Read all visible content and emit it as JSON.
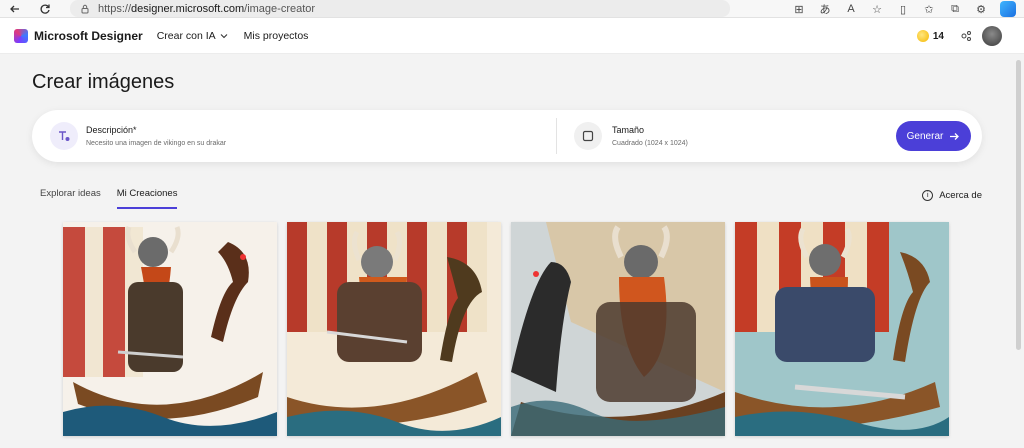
{
  "browser": {
    "url_scheme": "https://",
    "url_host": "designer.microsoft.com",
    "url_path": "/image-creator"
  },
  "header": {
    "brand": "Microsoft Designer",
    "menu": [
      {
        "label": "Crear con IA"
      },
      {
        "label": "Mis proyectos"
      }
    ],
    "coins": "14"
  },
  "main": {
    "title": "Crear imágenes",
    "prompt": {
      "description_label": "Descripción*",
      "description_value": "Necesito una imagen de vikingo en su drakar",
      "size_label": "Tamaño",
      "size_value": "Cuadrado (1024 x 1024)",
      "generate_label": "Generar"
    },
    "tabs": [
      {
        "label": "Explorar ideas"
      },
      {
        "label": "Mi Creaciones"
      }
    ],
    "about_label": "Acerca de"
  },
  "colors": {
    "accent": "#4b3fd8"
  },
  "gallery": [
    {
      "icon": "viking-drakkar-image-1"
    },
    {
      "icon": "viking-drakkar-image-2"
    },
    {
      "icon": "viking-drakkar-image-3"
    },
    {
      "icon": "viking-drakkar-image-4"
    }
  ]
}
